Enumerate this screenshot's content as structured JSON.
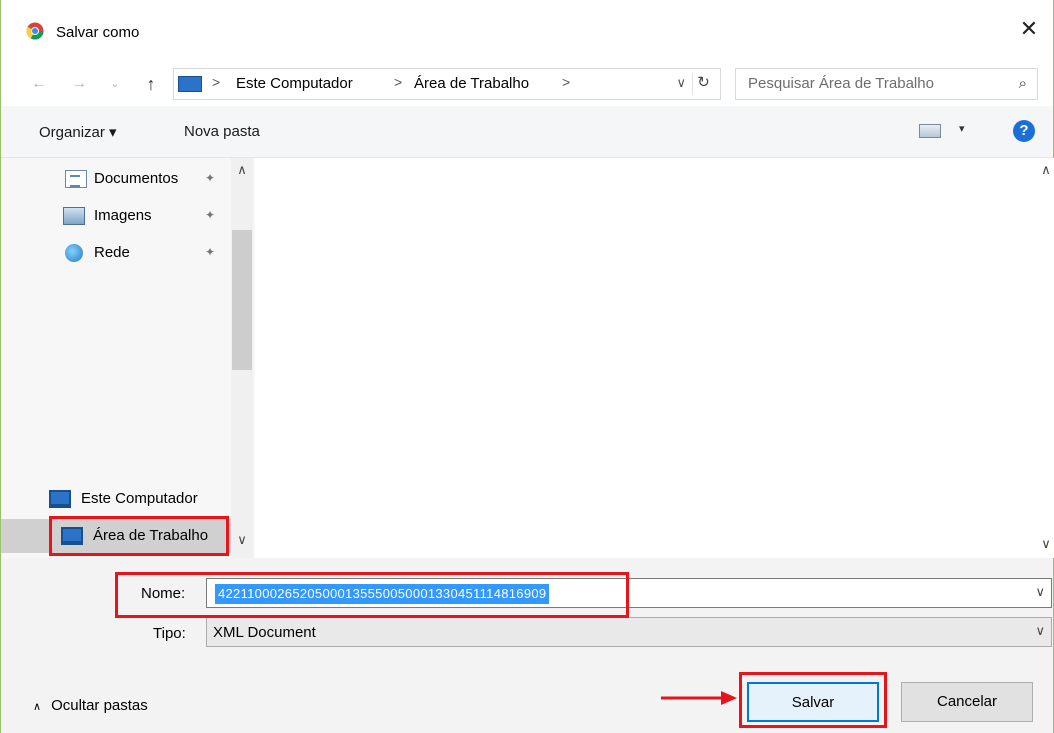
{
  "window": {
    "title": "Salvar como",
    "close_glyph": "✕",
    "app_icon": "chrome-icon"
  },
  "navigation": {
    "back_glyph": "←",
    "forward_glyph": "→",
    "recent_glyph": "⌄",
    "up_glyph": "↑"
  },
  "address_bar": {
    "location_icon": "monitor-icon",
    "separator": ">",
    "crumbs": [
      "Este Computador",
      "Área de Trabalho"
    ],
    "dropdown_glyph": "∨",
    "refresh_glyph": "↻"
  },
  "search": {
    "placeholder": "Pesquisar Área de Trabalho",
    "icon": "search-icon"
  },
  "toolbar": {
    "organize_label": "Organizar ▾",
    "new_folder_label": "Nova pasta",
    "view_caret": "▾",
    "help_label": "?"
  },
  "sidebar": {
    "quick_access": [
      {
        "label": "Documentos",
        "icon": "documents-icon",
        "pinned": true
      },
      {
        "label": "Imagens",
        "icon": "pictures-icon",
        "pinned": true
      },
      {
        "label": "Rede",
        "icon": "network-icon",
        "pinned": true
      }
    ],
    "pin_glyph": "📌",
    "computer": {
      "label": "Este Computador",
      "icon": "monitor-icon"
    },
    "desktop": {
      "label": "Área de Trabalho",
      "icon": "monitor-icon",
      "selected": true
    },
    "scroll_up": "∧",
    "scroll_down": "∨"
  },
  "file_list": {
    "items": [],
    "scroll_up": "∧",
    "scroll_down": "∨"
  },
  "form": {
    "name_label": "Nome:",
    "name_value": "42211000265205000135550050001330451114816909",
    "type_label": "Tipo:",
    "type_value": "XML Document",
    "combo_caret": "∨",
    "hide_folders_caret": "∧",
    "hide_folders_label": "Ocultar pastas",
    "save_label": "Salvar",
    "cancel_label": "Cancelar"
  },
  "annotations": {
    "highlight_color": "#e8141b",
    "highlights": [
      "desktop-folder",
      "file-name-field",
      "save-button"
    ],
    "arrow_target": "save-button"
  },
  "colors": {
    "selection_blue": "#3399ff",
    "primary_button_border": "#0078d7",
    "monitor_blue": "#2a73c8",
    "help_blue": "#1c6fd6"
  }
}
